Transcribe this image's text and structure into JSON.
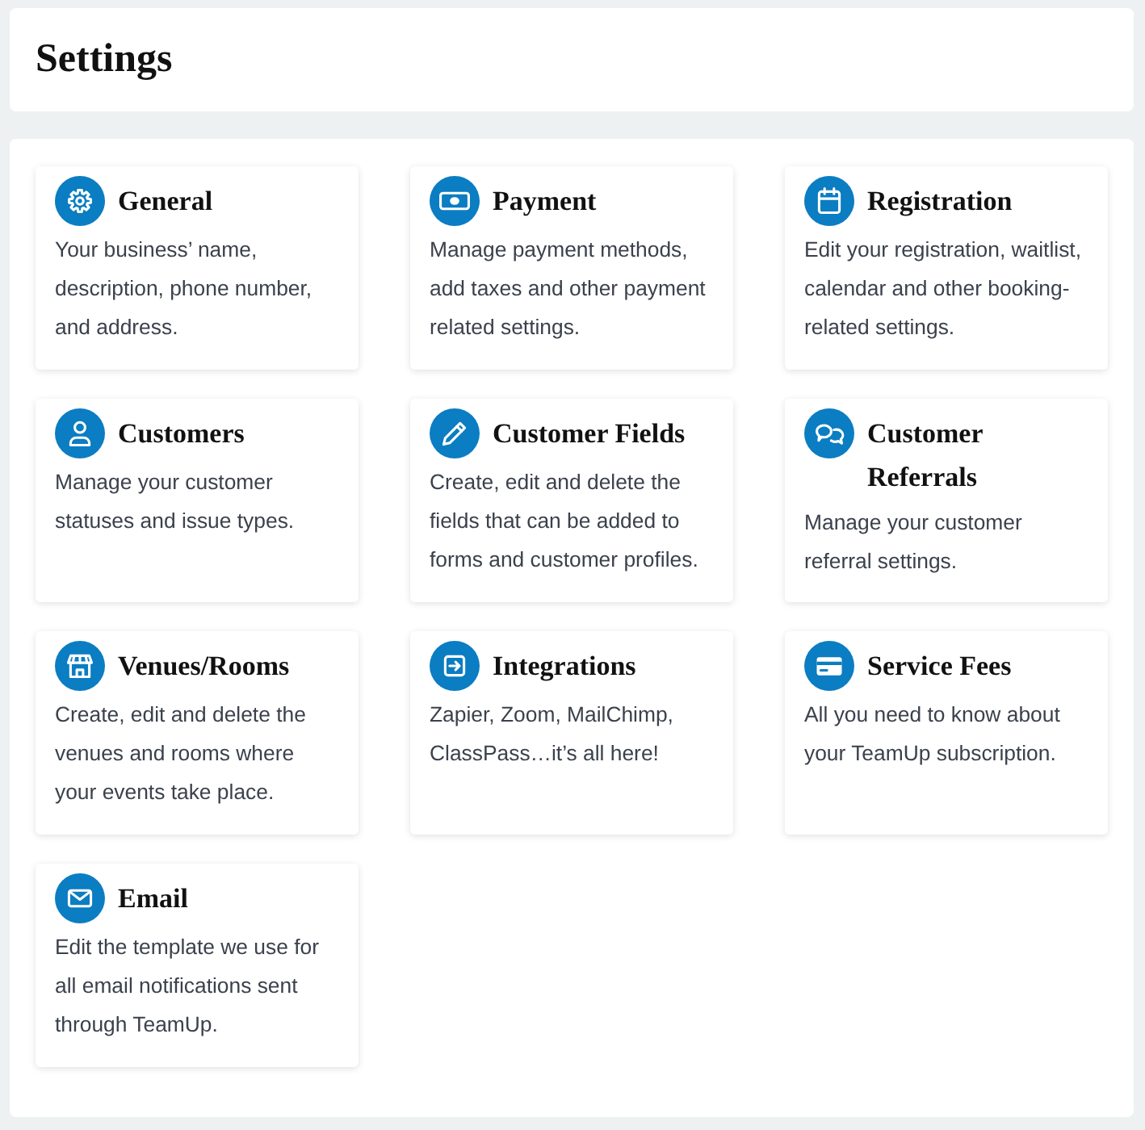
{
  "header": {
    "title": "Settings"
  },
  "cards": [
    {
      "title": "General",
      "description": "Your business’ name, description, phone number, and address."
    },
    {
      "title": "Payment",
      "description": "Manage payment methods, add taxes and other payment related settings."
    },
    {
      "title": "Registration",
      "description": "Edit your registration, waitlist, calendar and other booking-related settings."
    },
    {
      "title": "Customers",
      "description": "Manage your customer statuses and issue types."
    },
    {
      "title": "Customer Fields",
      "description": "Create, edit and delete the fields that can be added to forms and customer profiles."
    },
    {
      "title": "Customer Referrals",
      "description": "Manage your customer referral settings."
    },
    {
      "title": "Venues/Rooms",
      "description": "Create, edit and delete the venues and rooms where your events take place."
    },
    {
      "title": "Integrations",
      "description": "Zapier, Zoom, MailChimp, ClassPass…it’s all here!"
    },
    {
      "title": "Service Fees",
      "description": "All you need to know about your TeamUp subscription."
    },
    {
      "title": "Email",
      "description": "Edit the template we use for all email notifications sent through TeamUp."
    }
  ]
}
